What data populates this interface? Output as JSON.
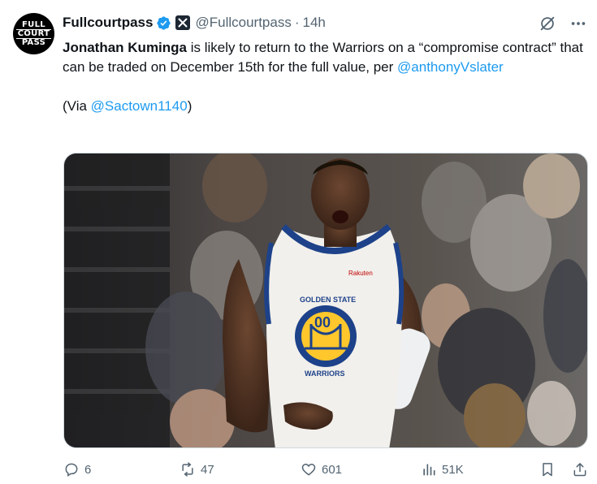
{
  "author": {
    "name": "Fullcourtpass",
    "handle": "@Fullcourtpass",
    "time": "14h",
    "avatar_lines": [
      "FULL",
      "COURT",
      "PASS"
    ]
  },
  "tweet": {
    "bold_name": "Jonathan Kuminga",
    "text_main": " is likely to return to the Warriors on a “compromise contract” that can be traded on December 15th for the full value, per ",
    "mention": "@anthonyVslater",
    "via_prefix": "(Via ",
    "via_mention": "@Sactown1140",
    "via_suffix": ")"
  },
  "media": {
    "jersey_top": "GOLDEN STATE",
    "jersey_number": "00",
    "jersey_bottom": "WARRIORS",
    "sponsor": "Rakuten"
  },
  "actions": {
    "replies": "6",
    "reposts": "47",
    "likes": "601",
    "views": "51K"
  },
  "colors": {
    "accent": "#1d9bf0",
    "muted": "#536471",
    "jersey_blue": "#1d428a",
    "jersey_gold": "#ffc72c"
  },
  "icons": [
    "verified-badge-icon",
    "affiliate-x-icon",
    "grok-icon",
    "more-icon",
    "reply-icon",
    "repost-icon",
    "like-icon",
    "views-icon",
    "bookmark-icon",
    "share-icon"
  ]
}
